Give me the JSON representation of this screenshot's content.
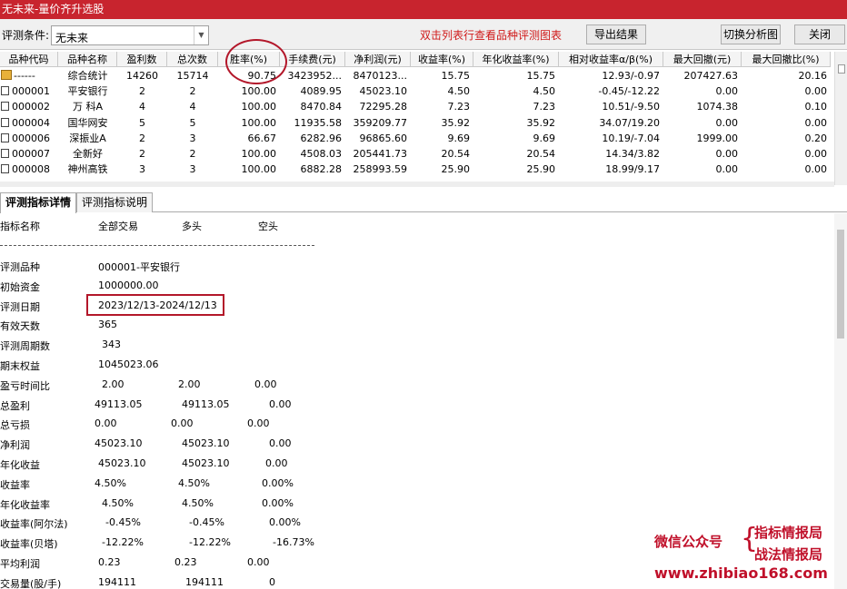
{
  "window": {
    "title": "无未来-量价齐升选股"
  },
  "toolbar": {
    "condition_label": "评测条件:",
    "condition_value": "无未来",
    "hint": "双击列表行查看品种评测图表",
    "export_label": "导出结果",
    "switch_label": "切换分析图",
    "close_label": "关闭"
  },
  "table": {
    "columns": [
      "品种代码",
      "品种名称",
      "盈利数",
      "总次数",
      "胜率(%)",
      "手续费(元)",
      "净利润(元)",
      "收益率(%)",
      "年化收益率(%)",
      "相对收益率α/β(%)",
      "最大回撤(元)",
      "最大回撤比(%)"
    ],
    "rows": [
      [
        "------",
        "综合统计",
        "14260",
        "15714",
        "90.75",
        "3423952...",
        "8470123...",
        "15.75",
        "15.75",
        "12.93/-0.97",
        "207427.63",
        "20.16"
      ],
      [
        "000001",
        "平安银行",
        "2",
        "2",
        "100.00",
        "4089.95",
        "45023.10",
        "4.50",
        "4.50",
        "-0.45/-12.22",
        "0.00",
        "0.00"
      ],
      [
        "000002",
        "万 科A",
        "4",
        "4",
        "100.00",
        "8470.84",
        "72295.28",
        "7.23",
        "7.23",
        "10.51/-9.50",
        "1074.38",
        "0.10"
      ],
      [
        "000004",
        "国华网安",
        "5",
        "5",
        "100.00",
        "11935.58",
        "359209.77",
        "35.92",
        "35.92",
        "34.07/19.20",
        "0.00",
        "0.00"
      ],
      [
        "000006",
        "深振业A",
        "2",
        "3",
        "66.67",
        "6282.96",
        "96865.60",
        "9.69",
        "9.69",
        "10.19/-7.04",
        "1999.00",
        "0.20"
      ],
      [
        "000007",
        "全新好",
        "2",
        "2",
        "100.00",
        "4508.03",
        "205441.73",
        "20.54",
        "20.54",
        "14.34/3.82",
        "0.00",
        "0.00"
      ],
      [
        "000008",
        "神州高铁",
        "3",
        "3",
        "100.00",
        "6882.28",
        "258993.59",
        "25.90",
        "25.90",
        "18.99/9.17",
        "0.00",
        "0.00"
      ]
    ]
  },
  "tabs": [
    "评测指标详情",
    "评测指标说明"
  ],
  "detail": {
    "headers": [
      "指标名称",
      "全部交易",
      "多头",
      "空头"
    ],
    "rows": [
      [
        "评测品种",
        "000001-平安银行",
        "",
        ""
      ],
      [
        "初始资金",
        "1000000.00",
        "",
        ""
      ],
      [
        "评测日期",
        "2023/12/13-2024/12/13",
        "",
        ""
      ],
      [
        "有效天数",
        "365",
        "",
        ""
      ],
      [
        "评测周期数",
        "343",
        "",
        ""
      ],
      [
        "期末权益",
        "1045023.06",
        "",
        ""
      ],
      [
        "盈亏时间比",
        "2.00",
        "2.00",
        "0.00"
      ],
      [
        "总盈利",
        "49113.05",
        "49113.05",
        "0.00"
      ],
      [
        "总亏损",
        "0.00",
        "0.00",
        "0.00"
      ],
      [
        "净利润",
        "45023.10",
        "45023.10",
        "0.00"
      ],
      [
        "年化收益",
        "45023.10",
        "45023.10",
        "0.00"
      ],
      [
        "收益率",
        "4.50%",
        "4.50%",
        "0.00%"
      ],
      [
        "年化收益率",
        "4.50%",
        "4.50%",
        "0.00%"
      ],
      [
        "收益率(阿尔法)",
        "-0.45%",
        "-0.45%",
        "0.00%"
      ],
      [
        "收益率(贝塔)",
        "-12.22%",
        "-12.22%",
        "-16.73%"
      ],
      [
        "平均利润",
        "0.23",
        "0.23",
        "0.00"
      ],
      [
        "交易量(股/手)",
        "194111",
        "194111",
        "0"
      ]
    ]
  },
  "watermark": {
    "wechat": "微信公众号",
    "line1": "指标情报局",
    "line2": "战法情报局",
    "url": "www.zhibiao168.com"
  },
  "colors": {
    "titlebar": "#c8242e",
    "annotation": "#b3172a",
    "hint": "#d01a1a"
  }
}
